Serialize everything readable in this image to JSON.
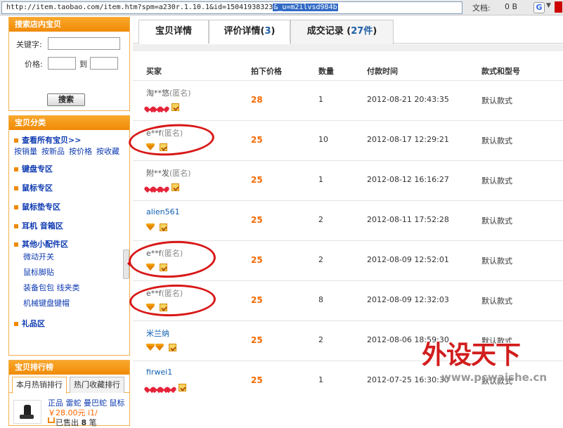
{
  "browser": {
    "url_prefix": "http://item.taobao.com/item.htm?spm=a230r.1.10.1&id=15041938323",
    "url_selected": "&_u=m2ilvsd984b",
    "doc_label": "文档:",
    "doc_size": "0 B",
    "g_letter": "G"
  },
  "sidebar": {
    "search": {
      "title": "搜索店内宝贝",
      "keyword_label": "关键字:",
      "price_label": "价格:",
      "to_label": "到",
      "button": "搜索"
    },
    "categories": {
      "title": "宝贝分类",
      "all": "查看所有宝贝>>",
      "sorts": [
        "按销量",
        "按新品",
        "按价格",
        "按收藏"
      ],
      "items": [
        "键盘专区",
        "鼠标专区",
        "鼠标垫专区",
        "耳机 音箱区",
        "其他小配件区"
      ],
      "sub_items": [
        "微动开关",
        "鼠标脚贴",
        "装备包包 线夹类",
        "机械键盘键帽"
      ],
      "last": "礼品区"
    },
    "ranking": {
      "title": "宝贝排行榜",
      "tabs": [
        "本月热销排行",
        "热门收藏排行"
      ],
      "item": {
        "title": "正品 雷蛇 曼巴蛇 鼠标",
        "price": "￥28.00元 i1/",
        "sold_label": "已售出",
        "sold_count": "8",
        "sold_unit": "笔"
      }
    }
  },
  "main": {
    "tabs": [
      {
        "label": "宝贝详情",
        "count": ""
      },
      {
        "label": "评价详情",
        "count": "3"
      },
      {
        "label": "成交记录",
        "count": "27件"
      }
    ],
    "columns": [
      "买家",
      "拍下价格",
      "数量",
      "付款时间",
      "款式和型号"
    ],
    "records": [
      {
        "buyer": "淘**悠",
        "anon": "(匿名)",
        "badge": "heart",
        "level": 3,
        "price": "28",
        "qty": "1",
        "time": "2012-08-21 20:43:35",
        "style": "默认款式"
      },
      {
        "buyer": "e**f",
        "anon": "(匿名)",
        "badge": "diamond",
        "level": 1,
        "price": "25",
        "qty": "10",
        "time": "2012-08-17 12:29:21",
        "style": "默认款式"
      },
      {
        "buyer": "附**发",
        "anon": "(匿名)",
        "badge": "heart",
        "level": 3,
        "price": "25",
        "qty": "1",
        "time": "2012-08-12 16:16:27",
        "style": "默认款式"
      },
      {
        "buyer": "alien561",
        "anon": "",
        "badge": "diamond",
        "level": 1,
        "price": "25",
        "qty": "2",
        "time": "2012-08-11 17:52:28",
        "style": "默认款式"
      },
      {
        "buyer": "e**f",
        "anon": "(匿名)",
        "badge": "diamond",
        "level": 1,
        "price": "25",
        "qty": "2",
        "time": "2012-08-09 12:52:01",
        "style": "默认款式"
      },
      {
        "buyer": "e**f",
        "anon": "(匿名)",
        "badge": "diamond",
        "level": 1,
        "price": "25",
        "qty": "8",
        "time": "2012-08-09 12:32:03",
        "style": "默认款式"
      },
      {
        "buyer": "米兰纳",
        "anon": "",
        "badge": "diamond",
        "level": 2,
        "price": "25",
        "qty": "2",
        "time": "2012-08-06 18:59:30",
        "style": "默认款式"
      },
      {
        "buyer": "firwei1",
        "anon": "",
        "badge": "heart",
        "level": 4,
        "price": "25",
        "qty": "1",
        "time": "2012-07-25 16:30:30",
        "style": "默认款式"
      }
    ]
  },
  "watermark": {
    "title": "外设天下",
    "url": "www.pcwaishe.cn"
  },
  "colors": {
    "sidebar_header": "#f08a07",
    "price": "#f56a00",
    "link": "#0d5fb1",
    "annotation_ring": "#d81818"
  }
}
